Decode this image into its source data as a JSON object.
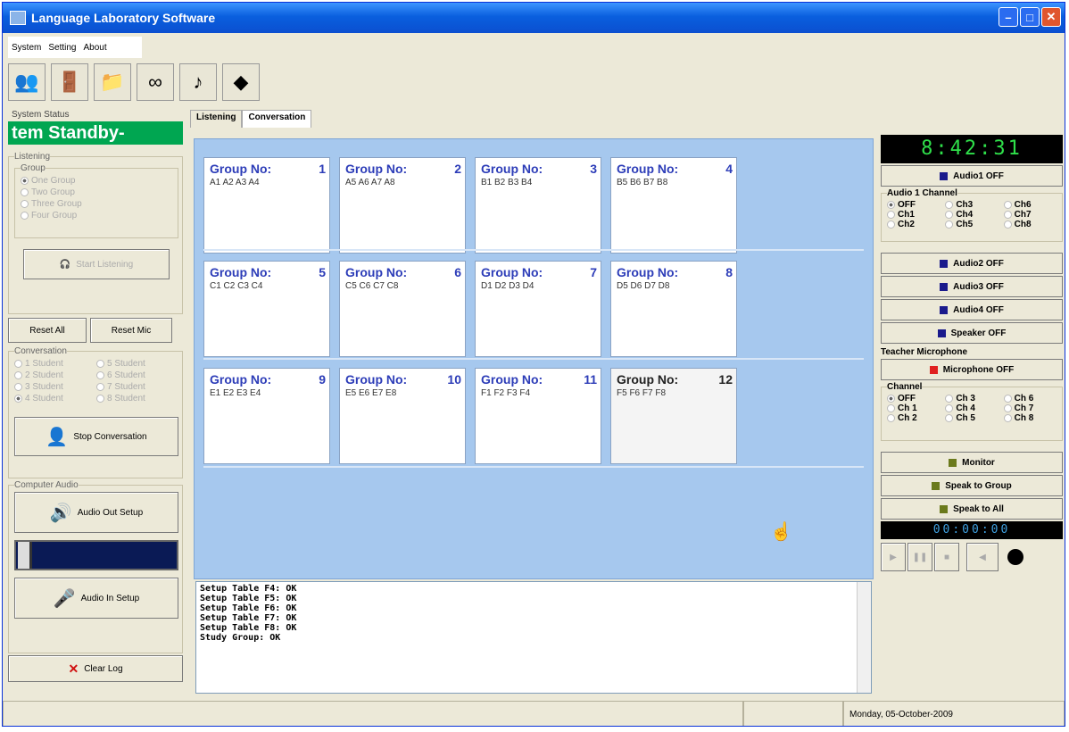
{
  "window": {
    "title": "Language Laboratory Software",
    "controls": [
      "minimize",
      "maximize",
      "close"
    ]
  },
  "menu": [
    "System",
    "Setting",
    "About"
  ],
  "toolbar": [
    "users-icon",
    "exit-icon",
    "folder-icon",
    "link-icon",
    "music-icon",
    "device-icon"
  ],
  "left": {
    "status_label": "System Status",
    "status_text": "tem Standby-",
    "listening": {
      "legend": "Listening",
      "group_legend": "Group",
      "options": [
        "One Group",
        "Two Group",
        "Three Group",
        "Four Group"
      ],
      "start_button": "Start Listening"
    },
    "reset_all": "Reset All",
    "reset_mic": "Reset Mic",
    "conversation": {
      "legend": "Conversation",
      "options": [
        "1 Student",
        "5 Student",
        "2 Student",
        "6 Student",
        "3 Student",
        "7 Student",
        "4 Student",
        "8 Student"
      ],
      "stop_button": "Stop Conversation"
    },
    "computer_audio": "Computer Audio",
    "audio_out": "Audio Out Setup",
    "audio_in": "Audio In Setup",
    "clear_log": "Clear Log"
  },
  "tabs": [
    "Listening",
    "Conversation"
  ],
  "groups": [
    {
      "label": "Group No:",
      "num": "1",
      "members": "A1 A2 A3 A4"
    },
    {
      "label": "Group No:",
      "num": "2",
      "members": "A5 A6 A7 A8"
    },
    {
      "label": "Group No:",
      "num": "3",
      "members": "B1 B2 B3 B4"
    },
    {
      "label": "Group No:",
      "num": "4",
      "members": "B5 B6 B7 B8"
    },
    {
      "label": "Group No:",
      "num": "5",
      "members": "C1 C2 C3 C4"
    },
    {
      "label": "Group No:",
      "num": "6",
      "members": "C5 C6 C7 C8"
    },
    {
      "label": "Group No:",
      "num": "7",
      "members": "D1 D2 D3 D4"
    },
    {
      "label": "Group No:",
      "num": "8",
      "members": "D5 D6 D7 D8"
    },
    {
      "label": "Group No:",
      "num": "9",
      "members": "E1 E2 E3 E4"
    },
    {
      "label": "Group No:",
      "num": "10",
      "members": "E5 E6 E7 E8"
    },
    {
      "label": "Group No:",
      "num": "11",
      "members": "F1 F2 F3 F4"
    },
    {
      "label": "Group No:",
      "num": "12",
      "members": "F5 F6 F7 F8"
    }
  ],
  "log": [
    "Setup Table F4: OK",
    "Setup Table F5: OK",
    "Setup Table F6: OK",
    "Setup Table F7: OK",
    "Setup Table F8: OK",
    "Study Group: OK"
  ],
  "right": {
    "clock": "8:42:31",
    "audio1": "Audio1 OFF",
    "audio1_channel": "Audio 1 Channel",
    "audio_channels": [
      "OFF",
      "Ch3",
      "Ch6",
      "Ch1",
      "Ch4",
      "Ch7",
      "Ch2",
      "Ch5",
      "Ch8"
    ],
    "audio2": "Audio2 OFF",
    "audio3": "Audio3 OFF",
    "audio4": "Audio4 OFF",
    "speaker": "Speaker OFF",
    "teacher_mic": "Teacher Microphone",
    "mic_off": "Microphone OFF",
    "channel": "Channel",
    "mic_channels": [
      "OFF",
      "Ch 3",
      "Ch 6",
      "Ch 1",
      "Ch 4",
      "Ch 7",
      "Ch 2",
      "Ch 5",
      "Ch 8"
    ],
    "monitor": "Monitor",
    "speak_group": "Speak to Group",
    "speak_all": "Speak to All",
    "timer": "00:00:00",
    "colors": {
      "audio": "#1a1a8c",
      "mic": "#e02020",
      "green": "#6b7a1c"
    }
  },
  "statusbar": {
    "date": "Monday, 05-October-2009"
  }
}
